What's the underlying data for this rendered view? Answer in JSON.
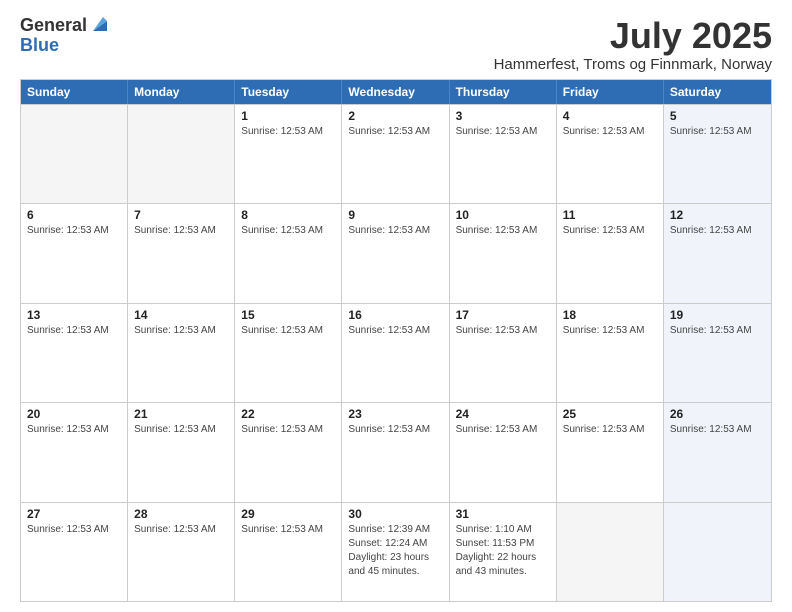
{
  "logo": {
    "general": "General",
    "blue": "Blue"
  },
  "title": "July 2025",
  "location": "Hammerfest, Troms og Finnmark, Norway",
  "days_of_week": [
    "Sunday",
    "Monday",
    "Tuesday",
    "Wednesday",
    "Thursday",
    "Friday",
    "Saturday"
  ],
  "weeks": [
    [
      {
        "day": "",
        "info": "",
        "empty": true
      },
      {
        "day": "",
        "info": "",
        "empty": true
      },
      {
        "day": "1",
        "info": "Sunrise: 12:53 AM"
      },
      {
        "day": "2",
        "info": "Sunrise: 12:53 AM"
      },
      {
        "day": "3",
        "info": "Sunrise: 12:53 AM"
      },
      {
        "day": "4",
        "info": "Sunrise: 12:53 AM"
      },
      {
        "day": "5",
        "info": "Sunrise: 12:53 AM",
        "saturday": true
      }
    ],
    [
      {
        "day": "6",
        "info": "Sunrise: 12:53 AM"
      },
      {
        "day": "7",
        "info": "Sunrise: 12:53 AM"
      },
      {
        "day": "8",
        "info": "Sunrise: 12:53 AM"
      },
      {
        "day": "9",
        "info": "Sunrise: 12:53 AM"
      },
      {
        "day": "10",
        "info": "Sunrise: 12:53 AM"
      },
      {
        "day": "11",
        "info": "Sunrise: 12:53 AM"
      },
      {
        "day": "12",
        "info": "Sunrise: 12:53 AM",
        "saturday": true
      }
    ],
    [
      {
        "day": "13",
        "info": "Sunrise: 12:53 AM"
      },
      {
        "day": "14",
        "info": "Sunrise: 12:53 AM"
      },
      {
        "day": "15",
        "info": "Sunrise: 12:53 AM"
      },
      {
        "day": "16",
        "info": "Sunrise: 12:53 AM"
      },
      {
        "day": "17",
        "info": "Sunrise: 12:53 AM"
      },
      {
        "day": "18",
        "info": "Sunrise: 12:53 AM"
      },
      {
        "day": "19",
        "info": "Sunrise: 12:53 AM",
        "saturday": true
      }
    ],
    [
      {
        "day": "20",
        "info": "Sunrise: 12:53 AM"
      },
      {
        "day": "21",
        "info": "Sunrise: 12:53 AM"
      },
      {
        "day": "22",
        "info": "Sunrise: 12:53 AM"
      },
      {
        "day": "23",
        "info": "Sunrise: 12:53 AM"
      },
      {
        "day": "24",
        "info": "Sunrise: 12:53 AM"
      },
      {
        "day": "25",
        "info": "Sunrise: 12:53 AM"
      },
      {
        "day": "26",
        "info": "Sunrise: 12:53 AM",
        "saturday": true
      }
    ],
    [
      {
        "day": "27",
        "info": "Sunrise: 12:53 AM"
      },
      {
        "day": "28",
        "info": "Sunrise: 12:53 AM"
      },
      {
        "day": "29",
        "info": "Sunrise: 12:53 AM"
      },
      {
        "day": "30",
        "info": "Sunrise: 12:39 AM\nSunset: 12:24 AM\nDaylight: 23 hours and 45 minutes."
      },
      {
        "day": "31",
        "info": "Sunrise: 1:10 AM\nSunset: 11:53 PM\nDaylight: 22 hours and 43 minutes."
      },
      {
        "day": "",
        "info": "",
        "empty": true
      },
      {
        "day": "",
        "info": "",
        "empty": true,
        "saturday": true
      }
    ]
  ]
}
